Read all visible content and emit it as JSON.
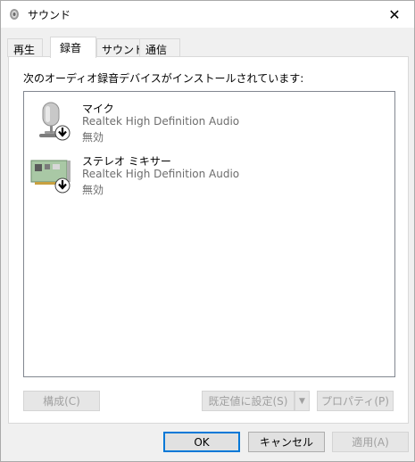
{
  "window": {
    "title": "サウンド",
    "close_glyph": "✕"
  },
  "tabs": [
    {
      "label": "再生"
    },
    {
      "label": "録音"
    },
    {
      "label": "サウンド"
    },
    {
      "label": "通信"
    }
  ],
  "panel": {
    "instruction": "次のオーディオ録音デバイスがインストールされています:"
  },
  "devices": [
    {
      "name": "マイク",
      "driver": "Realtek High Definition Audio",
      "status": "無効",
      "icon": "microphone-icon"
    },
    {
      "name": "ステレオ ミキサー",
      "driver": "Realtek High Definition Audio",
      "status": "無効",
      "icon": "sound-card-icon"
    }
  ],
  "panel_buttons": {
    "configure": "構成(C)",
    "set_default": "既定値に設定(S)",
    "properties": "プロパティ(P)"
  },
  "dialog_buttons": {
    "ok": "OK",
    "cancel": "キャンセル",
    "apply": "適用(A)"
  },
  "colors": {
    "focus_border": "#0078d7",
    "disabled_text": "#a0a0a0"
  }
}
